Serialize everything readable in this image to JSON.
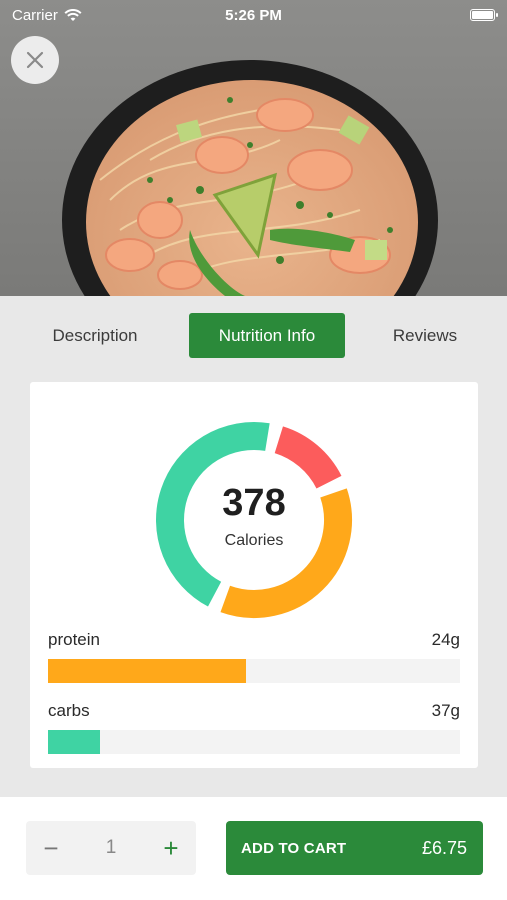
{
  "status_bar": {
    "carrier": "Carrier",
    "time": "5:26 PM"
  },
  "hero": {
    "image": "shrimp-pasta-bowl"
  },
  "tabs": [
    {
      "label": "Description",
      "active": false
    },
    {
      "label": "Nutrition Info",
      "active": true
    },
    {
      "label": "Reviews",
      "active": false
    }
  ],
  "nutrition": {
    "calories_value": "378",
    "calories_label": "Calories",
    "donut_segments": [
      {
        "name": "green",
        "color": "#3fd3a3",
        "fraction": 0.47
      },
      {
        "name": "red",
        "color": "#fc5c5c",
        "fraction": 0.15
      },
      {
        "name": "orange",
        "color": "#ffa81a",
        "fraction": 0.38
      }
    ],
    "macros": [
      {
        "name": "protein",
        "amount": "24g",
        "fill_fraction": 0.48,
        "color": "#ffa81a"
      },
      {
        "name": "carbs",
        "amount": "37g",
        "fill_fraction": 0.125,
        "color": "#3fd3a3"
      }
    ]
  },
  "cart": {
    "minus_symbol": "−",
    "quantity": "1",
    "plus_symbol": "+",
    "add_label": "ADD TO CART",
    "price": "£6.75"
  },
  "colors": {
    "accent": "#2b8a3a"
  }
}
